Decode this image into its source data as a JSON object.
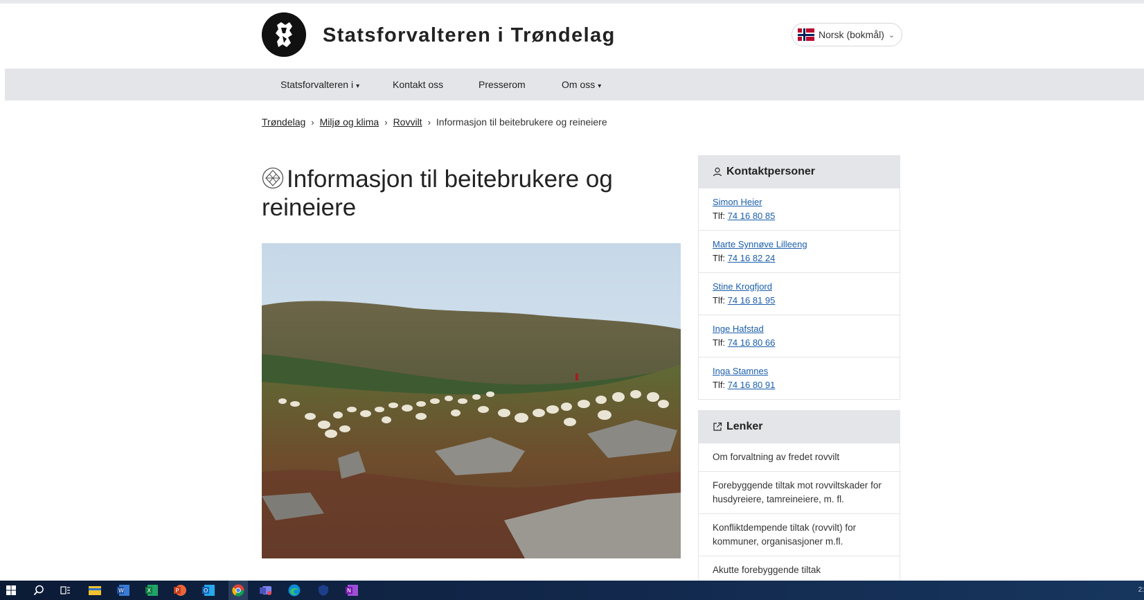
{
  "header": {
    "site_title": "Statsforvalteren i Trøndelag",
    "language": "Norsk (bokmål)"
  },
  "nav": {
    "items": [
      {
        "label": "Statsforvalteren i"
      },
      {
        "label": "Kontakt oss"
      },
      {
        "label": "Presserom"
      },
      {
        "label": "Om oss"
      }
    ]
  },
  "breadcrumb": [
    "Trøndelag",
    "Miljø og klima",
    "Rovvilt",
    "Informasjon til beitebrukere og reineiere"
  ],
  "page": {
    "title": "Informasjon til beitebrukere og reineiere"
  },
  "contacts": {
    "heading": "Kontaktpersoner",
    "phone_prefix": "Tlf:",
    "people": [
      {
        "name": "Simon Heier",
        "phone": "74 16 80 85"
      },
      {
        "name": "Marte Synnøve Lilleeng",
        "phone": "74 16 82 24"
      },
      {
        "name": "Stine Krogfjord",
        "phone": "74 16 81 95"
      },
      {
        "name": "Inge Hafstad",
        "phone": "74 16 80 66"
      },
      {
        "name": "Inga Stamnes",
        "phone": "74 16 80 91"
      }
    ]
  },
  "links": {
    "heading": "Lenker",
    "items": [
      "Om forvaltning av fredet rovvilt",
      "Forebyggende tiltak mot rovviltskader for husdyreiere, tamreineiere, m. fl.",
      "Konfliktdempende tiltak (rovvilt) for kommuner, organisasjoner m.fl.",
      "Akutte forebyggende tiltak"
    ]
  },
  "taskbar": {
    "clock": "2:",
    "icons": [
      "windows-start-icon",
      "search-icon",
      "task-view-icon",
      "file-explorer-icon",
      "word-icon",
      "excel-icon",
      "powerpoint-icon",
      "outlook-icon",
      "chrome-icon",
      "teams-icon",
      "edge-icon",
      "shield-icon",
      "onenote-icon"
    ]
  }
}
